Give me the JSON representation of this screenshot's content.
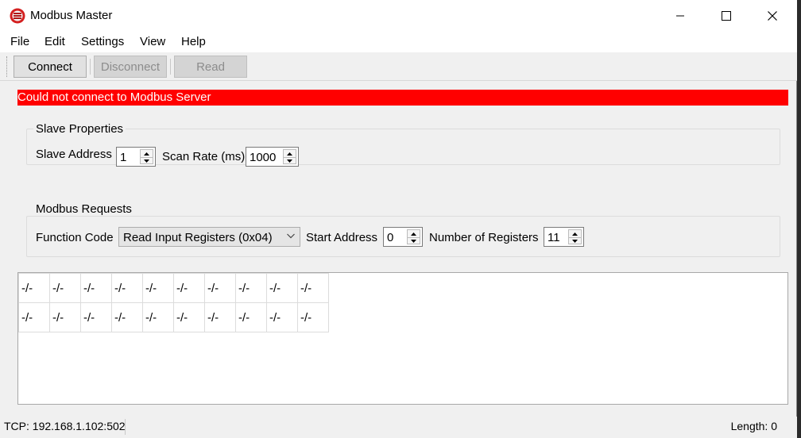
{
  "window": {
    "title": "Modbus Master"
  },
  "menu": {
    "items": [
      "File",
      "Edit",
      "Settings",
      "View",
      "Help"
    ]
  },
  "toolbar": {
    "connect_label": "Connect",
    "disconnect_label": "Disconnect",
    "read_label": "Read"
  },
  "error": {
    "message": "Could not connect to Modbus Server",
    "color": "#ff0000"
  },
  "slave": {
    "group_title": "Slave Properties",
    "address_label": "Slave Address",
    "address_value": "1",
    "scan_rate_label": "Scan Rate (ms)",
    "scan_rate_value": "1000"
  },
  "requests": {
    "group_title": "Modbus Requests",
    "function_code_label": "Function Code",
    "function_code_value": "Read Input Registers (0x04)",
    "start_address_label": "Start Address",
    "start_address_value": "0",
    "num_registers_label": "Number of Registers",
    "num_registers_value": "11"
  },
  "grid": {
    "rows": [
      [
        "-/-",
        "-/-",
        "-/-",
        "-/-",
        "-/-",
        "-/-",
        "-/-",
        "-/-",
        "-/-",
        "-/-"
      ],
      [
        "-/-",
        "-/-",
        "-/-",
        "-/-",
        "-/-",
        "-/-",
        "-/-",
        "-/-",
        "-/-",
        "-/-"
      ]
    ]
  },
  "status": {
    "connection": "TCP: 192.168.1.102:502",
    "length": "Length: 0"
  }
}
